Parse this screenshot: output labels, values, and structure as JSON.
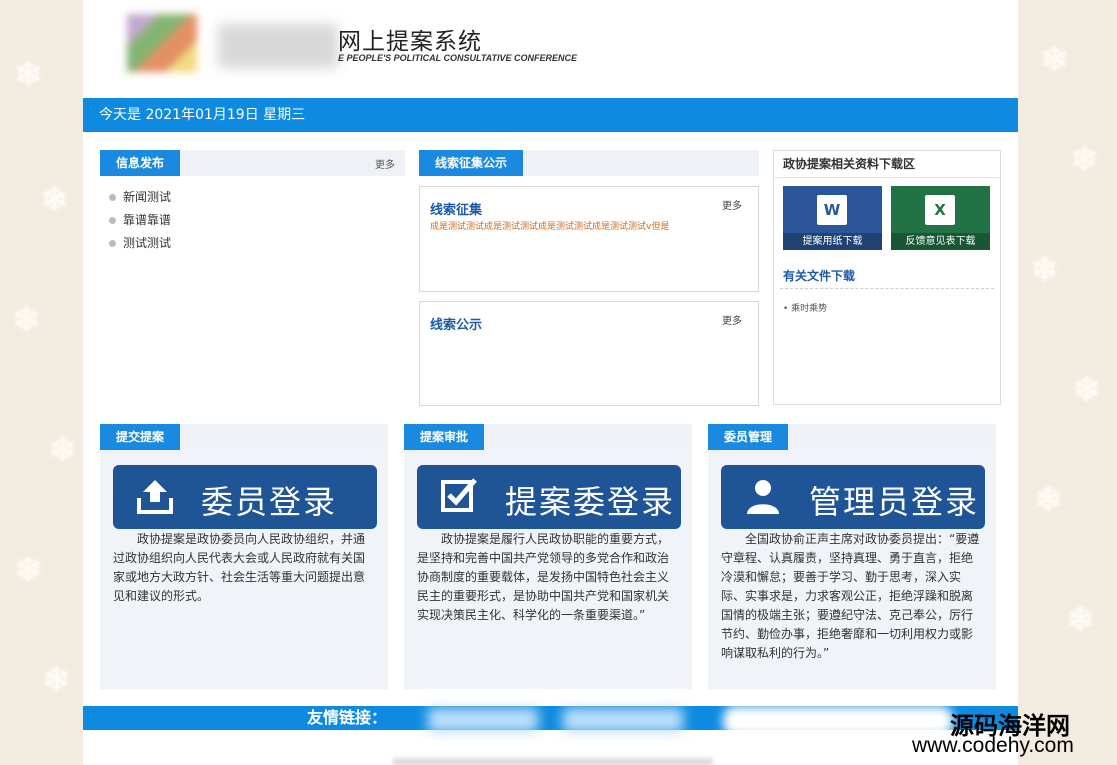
{
  "header": {
    "title": "网上提案系统",
    "subtitle": "E PEOPLE'S POLITICAL CONSULTATIVE CONFERENCE"
  },
  "datebar": {
    "text": "今天是 2021年01月19日 星期三"
  },
  "info": {
    "tab": "信息发布",
    "more": "更多",
    "items": [
      "新闻测试",
      "靠谱靠谱",
      "测试测试"
    ]
  },
  "clues": {
    "tab": "线索征集公示",
    "collect": {
      "title": "线索征集",
      "more": "更多",
      "text": "成是测试测试成是测试测试成是测试测试成是测试测试v但是"
    },
    "publicity": {
      "title": "线索公示",
      "more": "更多"
    }
  },
  "downloads": {
    "header": "政协提案相关资料下载区",
    "word": {
      "label": "提案用纸下载",
      "glyph": "W"
    },
    "excel": {
      "label": "反馈意见表下载",
      "glyph": "X"
    },
    "files_title": "有关文件下载",
    "files": [
      "乘时乘势"
    ]
  },
  "panels": [
    {
      "tab": "提交提案",
      "button": "委员登录",
      "icon": "upload-icon",
      "text": "政协提案是政协委员向人民政协组织，并通过政协组织向人民代表大会或人民政府就有关国家或地方大政方针、社会生活等重大问题提出意见和建议的形式。"
    },
    {
      "tab": "提案审批",
      "button": "提案委登录",
      "icon": "checkbox-icon",
      "text": "政协提案是履行人民政协职能的重要方式，是坚持和完善中国共产党领导的多党合作和政治协商制度的重要载体，是发扬中国特色社会主义民主的重要形式，是协助中国共产党和国家机关实现决策民主化、科学化的一条重要渠道。”"
    },
    {
      "tab": "委员管理",
      "button": "管理员登录",
      "icon": "user-icon",
      "text": "全国政协俞正声主席对政协委员提出：“要遵守章程、认真履责，坚持真理、勇于直言，拒绝冷漠和懈怠；要善于学习、勤于思考，深入实际、实事求是，力求客观公正，拒绝浮躁和脱离国情的极端主张；要遵纪守法、克己奉公，厉行节约、勤俭办事，拒绝奢靡和一切利用权力或影响谋取私利的行为。”"
    }
  ],
  "links": {
    "label": "友情链接："
  },
  "watermark": {
    "line1": "源码海洋网",
    "line2": "www.codehy.com"
  },
  "colors": {
    "primary": "#0e8be0",
    "navy": "#1f5496",
    "word": "#2b579a",
    "excel": "#217346",
    "orange": "#d46a1a"
  }
}
